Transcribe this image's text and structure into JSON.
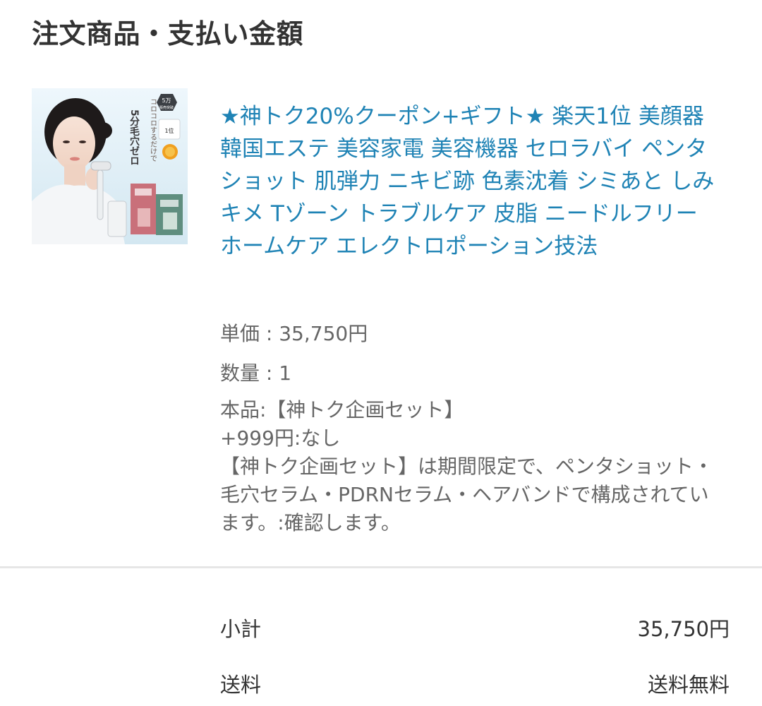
{
  "section": {
    "title": "注文商品・支払い金額"
  },
  "product": {
    "image_alt": "product-photo",
    "image_text": {
      "vertical_top": "コロコロするだけで",
      "vertical_bold": "5分毛穴ゼロ",
      "badge_line1": "5万",
      "badge_line2": "販売突破",
      "rank_label": "1位"
    },
    "title": "★神トク20%クーポン+ギフト★ 楽天1位 美顔器 韓国エステ 美容家電 美容機器 セロラバイ ペンタショット 肌弾力 ニキビ跡 色素沈着 シミあと しみ キメ Tゾーン トラブルケア 皮脂 ニードルフリー ホームケア エレクトロポーション技法",
    "unit_price": "単価 : 35,750円",
    "quantity": "数量 : 1",
    "options": [
      "本品:【神トク企画セット】",
      "+999円:なし",
      "【神トク企画セット】は期間限定で、ペンタショット・毛穴セラム・PDRNセラム・ヘアバンドで構成されています。:確認します。"
    ]
  },
  "summary": {
    "subtotal_label": "小計",
    "subtotal_value": "35,750円",
    "shipping_label": "送料",
    "shipping_value": "送料無料"
  },
  "colors": {
    "link": "#1f83b5",
    "text": "#333333",
    "muted": "#666666",
    "divider": "#e6e6e6"
  }
}
